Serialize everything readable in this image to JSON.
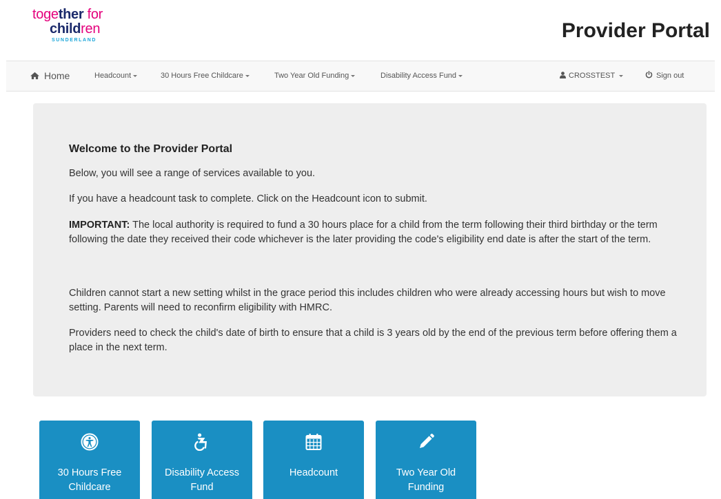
{
  "logo": {
    "line1_a": "toge",
    "line1_b": "ther",
    "line1_c": " for",
    "line2_a": "child",
    "line2_b": "ren",
    "line3": "SUNDERLAND"
  },
  "header": {
    "title": "Provider Portal"
  },
  "navbar": {
    "home": "Home",
    "items": [
      {
        "label": "Headcount"
      },
      {
        "label": "30 Hours Free Childcare"
      },
      {
        "label": "Two Year Old Funding"
      },
      {
        "label": "Disability Access Fund"
      }
    ],
    "user": "CROSSTEST",
    "signout": "Sign out"
  },
  "welcome": {
    "title": "Welcome to the Provider Portal",
    "p1": "Below, you will see a range of services available to you.",
    "p2": "If you have a headcount task to complete. Click on the Headcount icon to submit.",
    "p3_label": "IMPORTANT:",
    "p3_text": " The local authority is required to fund a 30 hours place for a child from the term following their third birthday or the term following the date they received their code whichever is the later providing the code's eligibility end date is after the start of the term.",
    "p4": "Children cannot start a new setting whilst in the grace period this includes children who were already accessing hours but wish to move setting. Parents will need to reconfirm eligibility with HMRC.",
    "p5": "Providers need to check the child's date of birth to ensure that a child is 3 years old by the end of the previous term before offering them a place in the next term."
  },
  "tiles": [
    {
      "label": "30 Hours Free Childcare",
      "icon": "accessibility-icon"
    },
    {
      "label": "Disability Access Fund",
      "icon": "wheelchair-icon"
    },
    {
      "label": "Headcount",
      "icon": "calendar-icon"
    },
    {
      "label": "Two Year Old Funding",
      "icon": "pencil-icon"
    }
  ],
  "colors": {
    "tile_bg": "#1a8fc3",
    "logo_pink": "#e4007c",
    "logo_navy": "#1b2a6b",
    "logo_cyan": "#1ba6d9",
    "jumbotron_bg": "#eeeeee"
  }
}
